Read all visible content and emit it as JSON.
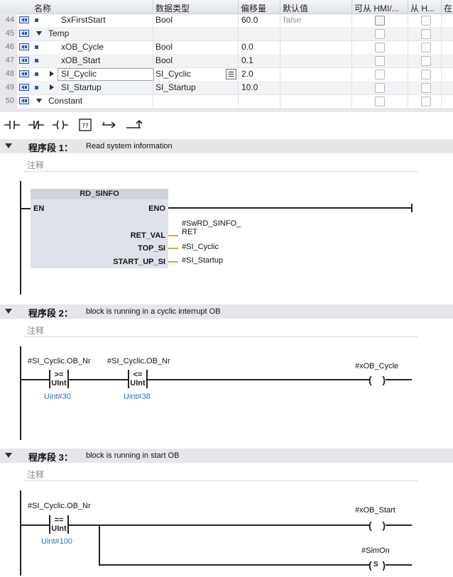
{
  "table": {
    "headers": [
      "名称",
      "数据类型",
      "偏移量",
      "默认值",
      "可从 HMI/...",
      "从 H...",
      "在"
    ],
    "rows": [
      {
        "num": "44",
        "name": "SxFirstStart",
        "type": "Bool",
        "offset": "60.0",
        "default": "false"
      },
      {
        "num": "45",
        "name": "Temp",
        "type": "",
        "offset": "",
        "default": ""
      },
      {
        "num": "46",
        "name": "xOB_Cycle",
        "type": "Bool",
        "offset": "0.0",
        "default": ""
      },
      {
        "num": "47",
        "name": "xOB_Start",
        "type": "Bool",
        "offset": "0.1",
        "default": ""
      },
      {
        "num": "48",
        "name": "SI_Cyclic",
        "type": "SI_Cyclic",
        "offset": "2.0",
        "default": ""
      },
      {
        "num": "49",
        "name": "SI_Startup",
        "type": "SI_Startup",
        "offset": "10.0",
        "default": ""
      },
      {
        "num": "50",
        "name": "Constant",
        "type": "",
        "offset": "",
        "default": ""
      }
    ]
  },
  "toolbar": {
    "icons": [
      "no-contact-icon",
      "nc-contact-icon",
      "coil-icon",
      "empty-box-icon",
      "open-branch-icon",
      "close-branch-icon"
    ]
  },
  "networks": [
    {
      "title": "程序段 1：",
      "desc": "Read system information",
      "comment": "注释"
    },
    {
      "title": "程序段 2：",
      "desc": "block is running in a cyclic interrupt OB",
      "comment": "注释"
    },
    {
      "title": "程序段 3：",
      "desc": "block is running in start OB",
      "comment": "注释"
    }
  ],
  "n1": {
    "block": "RD_SINFO",
    "en": "EN",
    "eno": "ENO",
    "ret_val": "RET_VAL",
    "top_si": "TOP_SI",
    "start_up_si": "START_UP_SI",
    "ret_param_1": "#SwRD_SINFO_",
    "ret_param_2": "RET",
    "top_param": "#SI_Cyclic",
    "start_param": "#SI_Startup"
  },
  "n2": {
    "op1_var": "#SI_Cyclic.OB_Nr",
    "op1": ">=",
    "op1_type": "UInt",
    "op1_const": "Uint#30",
    "op2_var": "#SI_Cyclic.OB_Nr",
    "op2": "<=",
    "op2_type": "UInt",
    "op2_const": "Uint#38",
    "coil_var": "#xOB_Cycle"
  },
  "n3": {
    "op_var": "#SI_Cyclic.OB_Nr",
    "op": "==",
    "op_type": "UInt",
    "op_const": "Uint#100",
    "coil1_var": "#xOB_Start",
    "coil2_var": "#SimOn",
    "coil2_type": "S"
  },
  "colors": {
    "header_bg": "#e4e6e9",
    "const_blue": "#2e6fc4",
    "param_orange": "#e8a13a",
    "fb_bg": "#dfe2ea"
  }
}
